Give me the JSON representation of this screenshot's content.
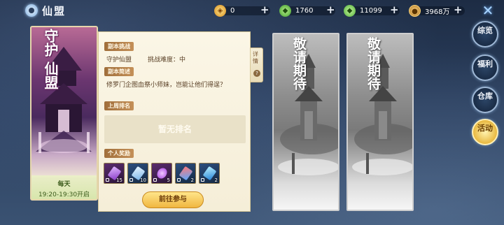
{
  "header": {
    "title": "仙盟",
    "resources": [
      {
        "name": "gold-ingot",
        "value": "0",
        "icon": "gold-ingot-icon"
      },
      {
        "name": "jade",
        "value": "1760",
        "icon": "jade-icon"
      },
      {
        "name": "bound-jade",
        "value": "11099",
        "icon": "bound-jade-icon"
      },
      {
        "name": "copper",
        "value": "3968万",
        "icon": "coin-icon"
      }
    ]
  },
  "banner": {
    "title_line1": "守护",
    "title_line2": "仙盟",
    "schedule_day": "每天",
    "schedule_hours": "19:20-19:30开启"
  },
  "panel": {
    "challenge_tag": "副本挑战",
    "dungeon_name": "守护仙盟",
    "difficulty": "挑战难度：中",
    "intro_tag": "副本简述",
    "intro_text": "修罗门企图血祭小师妹，岂能让他们得逞？",
    "rank_tag": "上周排名",
    "rank_empty": "暂无排名",
    "reward_tag": "个人奖励",
    "rewards": [
      {
        "count": "15",
        "icon": "purple-crystal-icon"
      },
      {
        "count": "10",
        "icon": "blue-feather-icon"
      },
      {
        "count": "5",
        "icon": "purple-flame-icon"
      },
      {
        "count": "2",
        "icon": "red-blue-crystal-icon"
      },
      {
        "count": "2",
        "icon": "blue-crystal-icon"
      }
    ],
    "go_button": "前往参与",
    "detail_tab": "详情"
  },
  "coming_soon": [
    {
      "title": "敬请期待"
    },
    {
      "title": "敬请期待"
    }
  ],
  "side_menu": [
    {
      "label": "综览",
      "active": false
    },
    {
      "label": "福利",
      "active": false
    },
    {
      "label": "仓库",
      "active": false
    },
    {
      "label": "活动",
      "active": true
    }
  ],
  "colors": {
    "panel_bg": "#fbf6e6",
    "tag_bg": "#a06e3a",
    "button_gold": "#f0b640"
  }
}
